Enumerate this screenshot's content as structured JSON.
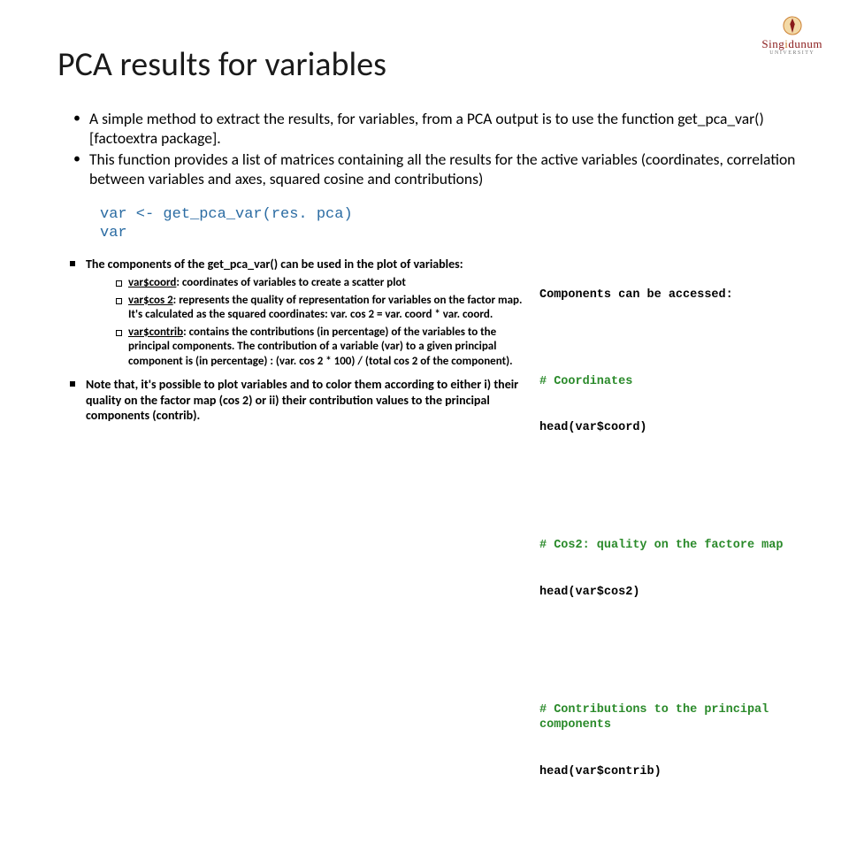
{
  "logo": {
    "brand_pre": "Sing",
    "brand_accent": "i",
    "brand_post": "dunum",
    "sub": "UNIVERSITY"
  },
  "title": "PCA results for variables",
  "bullets_top": [
    "A simple method to extract the results, for variables, from a PCA output is to use the function get_pca_var() [factoextra package].",
    "This function provides a list of matrices containing all the results for the active variables (coordinates, correlation between variables and axes, squared cosine and contributions)"
  ],
  "code": "var <- get_pca_var(res. pca)\nvar",
  "components_intro_pre": "The components of the ",
  "components_intro_fn": "get_pca_var()",
  "components_intro_post": " can be used in the plot of variables:",
  "sub_items": [
    {
      "key": "var$coord",
      "text": ": coordinates of variables to create a scatter plot"
    },
    {
      "key": "var$cos 2",
      "text": ": represents the quality of representation for variables on the factor map. It's calculated as the squared coordinates: var. cos 2 = var. coord * var. coord."
    },
    {
      "key": "var$contrib",
      "text": ": contains the contributions (in percentage) of the variables to the principal components. The contribution of a variable (var) to a given principal component is (in percentage) : (var. cos 2 * 100) / (total cos 2 of the component)."
    }
  ],
  "note": "Note that, it's possible to plot variables and to color them according to either i) their quality on the factor map (cos 2) or ii) their contribution values to the principal components (contrib).",
  "access": {
    "heading": "Components can be accessed:",
    "blocks": [
      {
        "comment": "# Coordinates",
        "code": "head(var$coord)"
      },
      {
        "comment": "# Cos2: quality on the factore map",
        "code": "head(var$cos2)"
      },
      {
        "comment": "# Contributions to the principal components",
        "code": "head(var$contrib)"
      }
    ]
  }
}
